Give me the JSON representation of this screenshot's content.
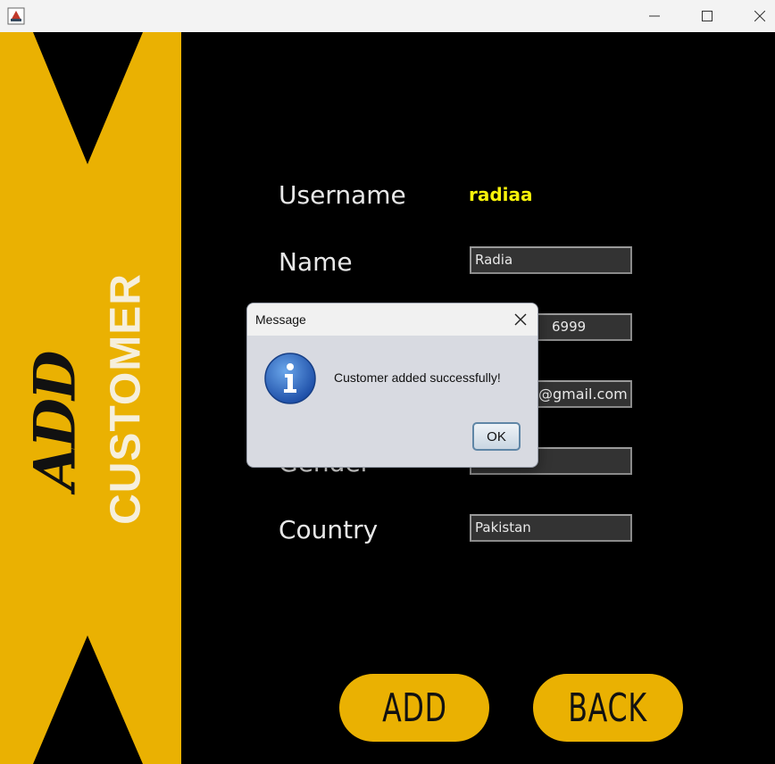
{
  "window": {
    "app_icon": "java-app-icon",
    "controls": [
      "minimize-icon",
      "maximize-icon",
      "close-icon"
    ]
  },
  "sidebar": {
    "add_text": "ADD",
    "customer_text": "CUSTOMER",
    "background": "#eab102"
  },
  "form": {
    "username_label": "Username",
    "username_value": "radiaa",
    "name_label": "Name",
    "name_value": "Radia",
    "phone_value_visible": "6999",
    "email_value_visible": "@gmail.com",
    "gender_label_visible": "Gender",
    "gender_value": "",
    "country_label": "Country",
    "country_value": "Pakistan"
  },
  "buttons": {
    "add_label": "ADD",
    "back_label": "BACK",
    "color": "#eab102"
  },
  "dialog": {
    "title": "Message",
    "message": "Customer added successfully!",
    "ok_label": "OK",
    "icon": "info-icon"
  }
}
